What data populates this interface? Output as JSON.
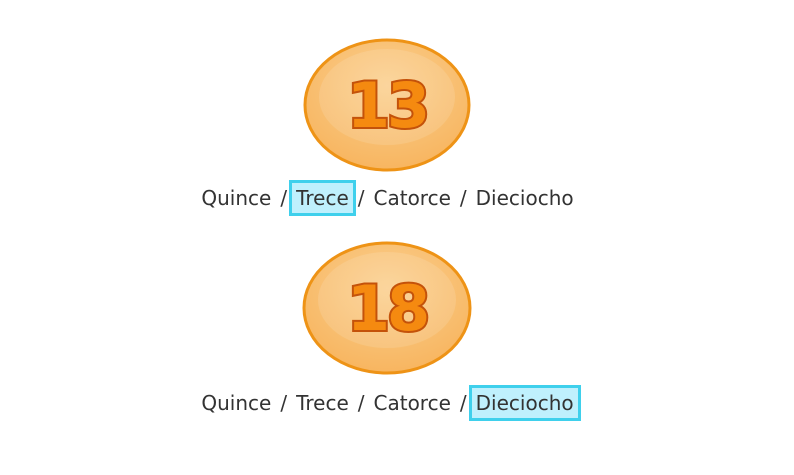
{
  "questions": [
    {
      "number": "13",
      "options": [
        "Quince",
        "Trece",
        "Catorce",
        "Dieciocho"
      ],
      "selected": "Trece",
      "separator": "/"
    },
    {
      "number": "18",
      "options": [
        "Quince",
        "Trece",
        "Catorce",
        "Dieciocho"
      ],
      "selected": "Dieciocho",
      "separator": "/"
    }
  ],
  "colors": {
    "badge_fill": "#f8b864",
    "badge_stroke": "#ee9316",
    "number_fill": "#f58a10",
    "number_stroke": "#c4520a",
    "selected_bg": "#bff0fd",
    "selected_border": "#3fd0ec"
  }
}
